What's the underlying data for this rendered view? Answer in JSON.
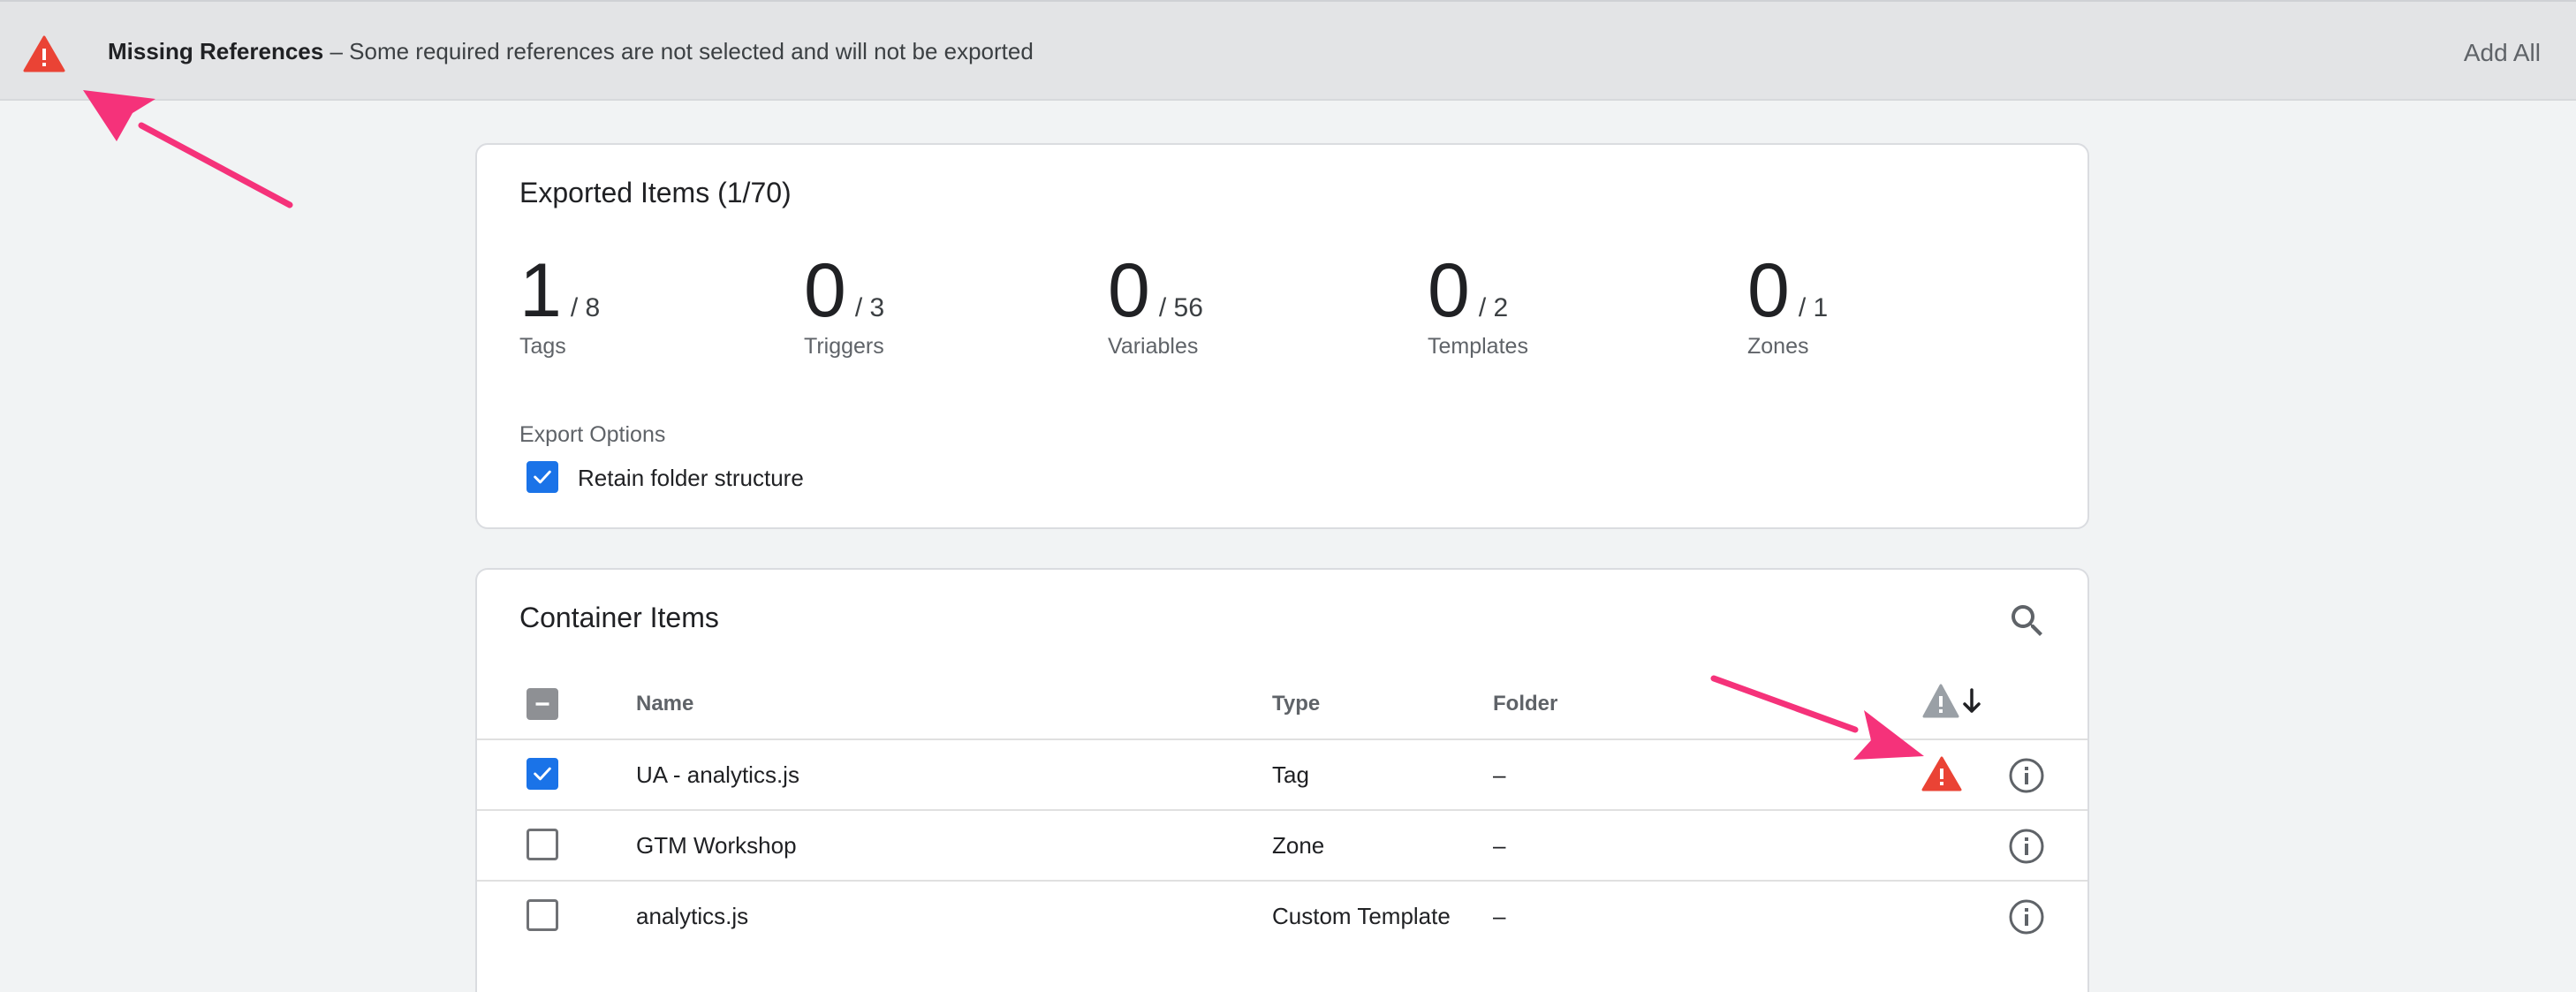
{
  "banner": {
    "title": "Missing References",
    "message": "– Some required references are not selected and will not be exported",
    "add_all": "Add All"
  },
  "export": {
    "title": "Exported Items (1/70)",
    "stats": [
      {
        "value": "1",
        "total": "/ 8",
        "label": "Tags"
      },
      {
        "value": "0",
        "total": "/ 3",
        "label": "Triggers"
      },
      {
        "value": "0",
        "total": "/ 56",
        "label": "Variables"
      },
      {
        "value": "0",
        "total": "/ 2",
        "label": "Templates"
      },
      {
        "value": "0",
        "total": "/ 1",
        "label": "Zones"
      }
    ],
    "options_label": "Export Options",
    "retain_folder": {
      "label": "Retain folder structure",
      "checked": true
    }
  },
  "items": {
    "title": "Container Items",
    "columns": {
      "name": "Name",
      "type": "Type",
      "folder": "Folder"
    },
    "rows": [
      {
        "name": "UA - analytics.js",
        "type": "Tag",
        "folder": "–",
        "checked": true,
        "warning": true
      },
      {
        "name": "GTM Workshop",
        "type": "Zone",
        "folder": "–",
        "checked": false,
        "warning": false
      },
      {
        "name": "analytics.js",
        "type": "Custom Template",
        "folder": "–",
        "checked": false,
        "warning": false
      }
    ]
  },
  "colors": {
    "warning": "#ea4335",
    "accent": "#1a73e8",
    "annotation_arrow": "#f5327a"
  }
}
